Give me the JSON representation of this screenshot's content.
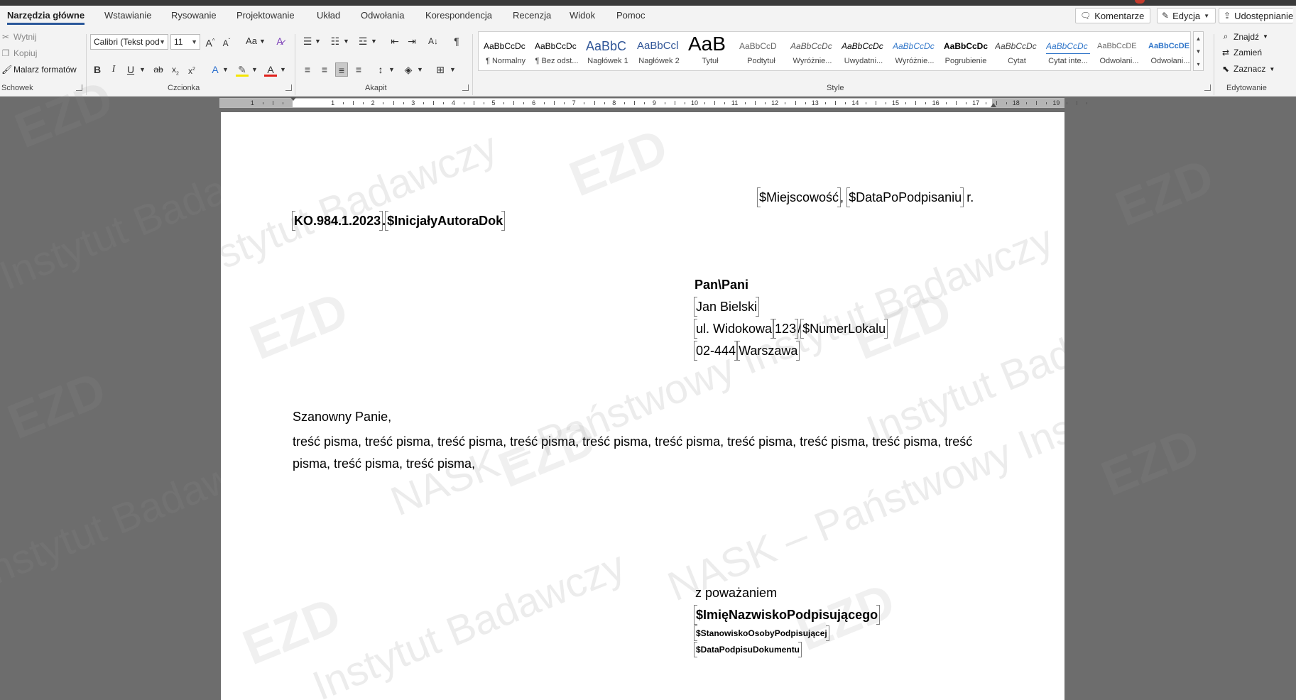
{
  "ribbon": {
    "tabs": [
      "Narzędzia główne",
      "Wstawianie",
      "Rysowanie",
      "Projektowanie",
      "Układ",
      "Odwołania",
      "Korespondencja",
      "Recenzja",
      "Widok",
      "Pomoc"
    ],
    "active_tab": "Narzędzia główne",
    "right_buttons": {
      "comments": "Komentarze",
      "editing": "Edycja",
      "share": "Udostępnianie"
    },
    "clipboard": {
      "cut": "Wytnij",
      "copy": "Kopiuj",
      "format_painter": "Malarz formatów",
      "label": "Schowek"
    },
    "font": {
      "name": "Calibri (Tekst pod",
      "size": "11",
      "label": "Czcionka",
      "case_btn": "Aa"
    },
    "paragraph": {
      "label": "Akapit"
    },
    "styles": {
      "label": "Style",
      "items": [
        {
          "preview": "AaBbCcDc",
          "name": "¶ Normalny"
        },
        {
          "preview": "AaBbCcDc",
          "name": "¶ Bez odst..."
        },
        {
          "preview": "AaBbC",
          "name": "Nagłówek 1"
        },
        {
          "preview": "AaBbCcl",
          "name": "Nagłówek 2"
        },
        {
          "preview": "AaB",
          "name": "Tytuł"
        },
        {
          "preview": "AaBbCcD",
          "name": "Podtytuł"
        },
        {
          "preview": "AaBbCcDc",
          "name": "Wyróżnie..."
        },
        {
          "preview": "AaBbCcDc",
          "name": "Uwydatni..."
        },
        {
          "preview": "AaBbCcDc",
          "name": "Wyróżnie..."
        },
        {
          "preview": "AaBbCcDc",
          "name": "Pogrubienie"
        },
        {
          "preview": "AaBbCcDc",
          "name": "Cytat"
        },
        {
          "preview": "AaBbCcDc",
          "name": "Cytat inte..."
        },
        {
          "preview": "AaBbCcDE",
          "name": "Odwołani..."
        },
        {
          "preview": "AaBbCcDE",
          "name": "Odwołani..."
        }
      ]
    },
    "editing": {
      "find": "Znajdź",
      "replace": "Zamień",
      "select": "Zaznacz",
      "label": "Edytowanie"
    }
  },
  "ruler": {
    "numbers": [
      "1",
      "1",
      "2",
      "3",
      "4",
      "5",
      "6",
      "7",
      "8",
      "9",
      "10",
      "11",
      "12",
      "13",
      "14",
      "15",
      "16",
      "17",
      "18",
      "19"
    ]
  },
  "document": {
    "place_field": "$Miejscowość",
    "date_field": "$DataPoPodpisaniu",
    "date_suffix": " r.",
    "reference": "KO.984.1.2023",
    "reference_dot": ".",
    "initials_field": "$InicjałyAutoraDok",
    "salutation_recipient": "Pan\\Pani",
    "recipient_name": "Jan Bielski",
    "street": "ul. Widokowa",
    "house_number": "123",
    "unit_separator": "/",
    "unit_field": "$NumerLokalu",
    "postal_code": "02-444",
    "city": "Warszawa",
    "greeting": "Szanowny Panie,",
    "body": "treść pisma, treść pisma, treść pisma, treść pisma, treść pisma, treść pisma, treść pisma, treść pisma, treść pisma, treść pisma, treść pisma, treść pisma,",
    "closing": "z poważaniem",
    "signer_field": "$ImięNazwiskoPodpisującego",
    "signer_position_field": "$StanowiskoOsobyPodpisującej",
    "signature_date_field": "$DataPodpisuDokumentu"
  },
  "watermark": {
    "institute": "Instytut Badawczy",
    "nask": "NASK – Państwowy Instytut Badawczy",
    "ezd": "EZD"
  },
  "colors": {
    "accent": "#2b579a",
    "background": "#6d6d6d",
    "ribbon": "#f3f3f3"
  }
}
